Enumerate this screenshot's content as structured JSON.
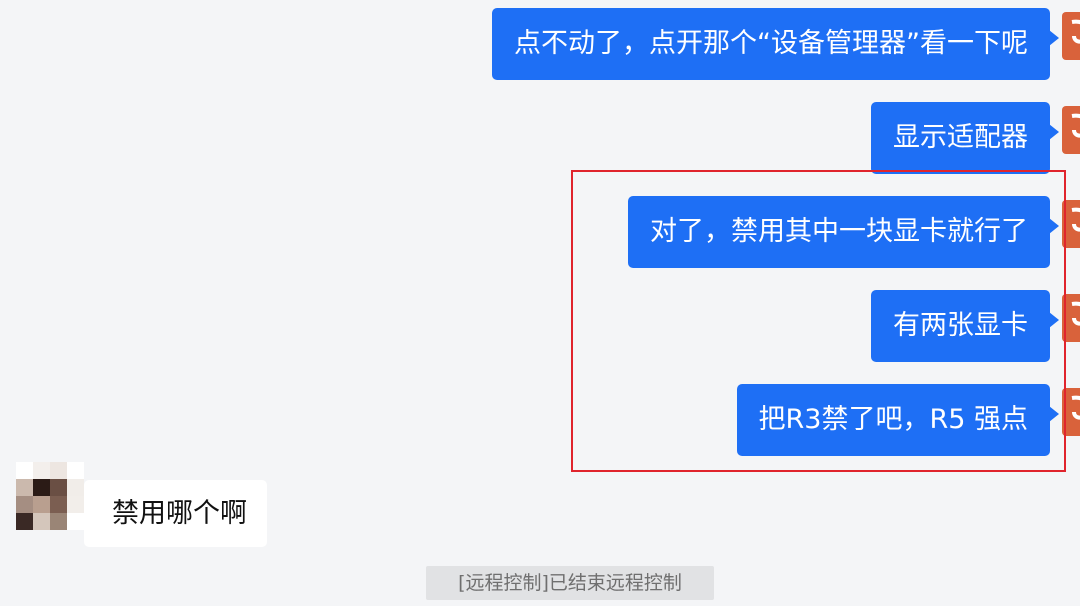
{
  "conversation": {
    "outgoing": [
      "点不动了，点开那个“设备管理器”看一下呢",
      "显示适配器",
      "对了，禁用其中一块显卡就行了",
      "有两张显卡",
      "把R3禁了吧，R5 强点"
    ],
    "incoming": [
      "禁用哪个啊"
    ],
    "system_notice": "[远程控制]已结束远程控制"
  },
  "colors": {
    "background": "#f4f5f7",
    "outgoing_bubble": "#1e6ff5",
    "incoming_bubble": "#ffffff",
    "highlight_box": "#e0242d",
    "self_avatar": "#d9623b",
    "notice_bg": "#e1e2e4"
  },
  "icons": {
    "self_avatar": "avatar-icon",
    "peer_avatar": "pixelated-avatar"
  }
}
